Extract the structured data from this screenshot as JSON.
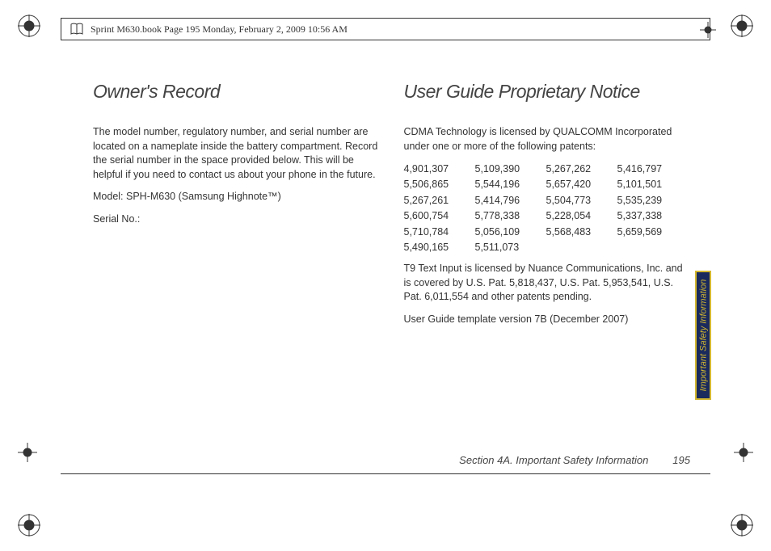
{
  "header": {
    "text": "Sprint M630.book  Page 195  Monday, February 2, 2009  10:56 AM"
  },
  "left": {
    "heading": "Owner's Record",
    "p1": "The model number, regulatory number, and serial number are located on a nameplate inside the battery compartment. Record the serial number in the space provided below. This will be helpful if you need to contact us about your phone in the future.",
    "model": "Model:  SPH-M630 (Samsung Highnote™)",
    "serial": "Serial No.:"
  },
  "right": {
    "heading": "User Guide Proprietary Notice",
    "p1": "CDMA Technology is licensed by QUALCOMM Incorporated under one or more of the following patents:",
    "patents": [
      [
        "4,901,307",
        "5,109,390",
        "5,267,262",
        "5,416,797"
      ],
      [
        "5,506,865",
        "5,544,196",
        "5,657,420",
        "5,101,501"
      ],
      [
        "5,267,261",
        "5,414,796",
        "5,504,773",
        "5,535,239"
      ],
      [
        "5,600,754",
        "5,778,338",
        "5,228,054",
        "5,337,338"
      ],
      [
        "5,710,784",
        "5,056,109",
        "5,568,483",
        "5,659,569"
      ],
      [
        "5,490,165",
        "5,511,073",
        "",
        ""
      ]
    ],
    "p2": "T9 Text Input is licensed by Nuance Communications, Inc. and is covered by U.S. Pat. 5,818,437, U.S. Pat. 5,953,541, U.S. Pat. 6,011,554 and other patents pending.",
    "p3": "User Guide template version 7B (December 2007)"
  },
  "sideTab": "Important Safety Information",
  "footer": {
    "section": "Section 4A. Important Safety Information",
    "page": "195"
  }
}
